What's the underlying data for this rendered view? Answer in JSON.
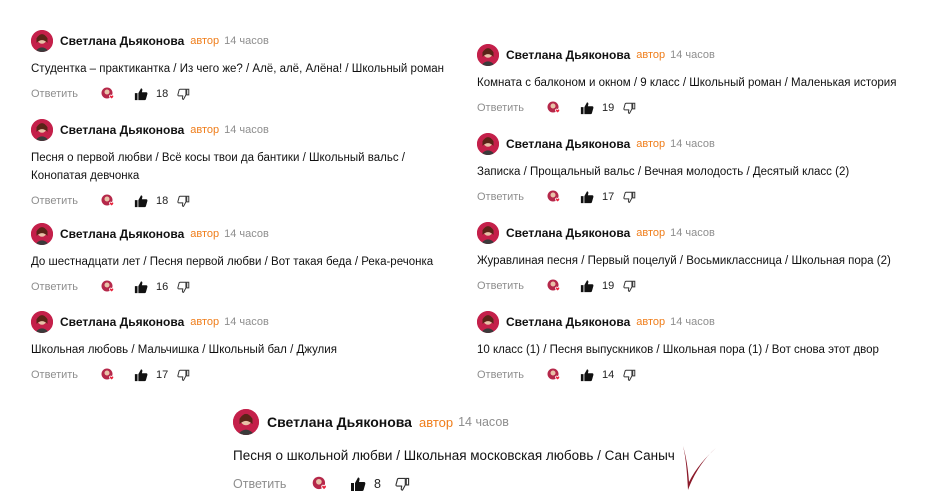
{
  "comments": [
    {
      "author": "Светлана Дьяконова",
      "badge": "автор",
      "time": "14 часов",
      "text": "Студентка – практикантка / Из чего же? / Алё, алё, Алёна! / Школьный роман",
      "reply": "Ответить",
      "likes": "18"
    },
    {
      "author": "Светлана Дьяконова",
      "badge": "автор",
      "time": "14 часов",
      "text": "Песня о первой любви / Всё косы твои да бантики / Школьный вальс / Конопатая девчонка",
      "reply": "Ответить",
      "likes": "18"
    },
    {
      "author": "Светлана Дьяконова",
      "badge": "автор",
      "time": "14 часов",
      "text": "До шестнадцати лет / Песня первой любви / Вот такая беда / Река-речонка",
      "reply": "Ответить",
      "likes": "16"
    },
    {
      "author": "Светлана Дьяконова",
      "badge": "автор",
      "time": "14 часов",
      "text": "Школьная любовь / Мальчишка / Школьный бал / Джулия",
      "reply": "Ответить",
      "likes": "17"
    },
    {
      "author": "Светлана Дьяконова",
      "badge": "автор",
      "time": "14 часов",
      "text": "Комната с балконом и окном / 9 класс / Школьный роман / Маленькая история",
      "reply": "Ответить",
      "likes": "19"
    },
    {
      "author": "Светлана Дьяконова",
      "badge": "автор",
      "time": "14 часов",
      "text": "Записка / Прощальный вальс / Вечная молодость / Десятый класс (2)",
      "reply": "Ответить",
      "likes": "17"
    },
    {
      "author": "Светлана Дьяконова",
      "badge": "автор",
      "time": "14 часов",
      "text": "Журавлиная песня / Первый поцелуй / Восьмиклассница / Школьная пора (2)",
      "reply": "Ответить",
      "likes": "19"
    },
    {
      "author": "Светлана Дьяконова",
      "badge": "автор",
      "time": "14 часов",
      "text": "10 класс (1) / Песня выпускников / Школьная пора (1) / Вот снова этот двор",
      "reply": "Ответить",
      "likes": "14"
    },
    {
      "author": "Светлана Дьяконова",
      "badge": "автор",
      "time": "14 часов",
      "text": "Песня о школьной любви / Школьная московская любовь / Сан Саныч",
      "reply": "Ответить",
      "likes": "8"
    }
  ],
  "icons": {
    "avatar": "avatar-portrait",
    "reaction": "reaction-heart-icon",
    "like": "thumbs-up-icon",
    "dislike": "thumbs-down-icon",
    "mark": "checkmark-icon"
  },
  "colors": {
    "author_badge": "#ef7d1a",
    "muted": "#8e8e8e",
    "avatar_bg": "#c4204a",
    "checkmark": "#8b1a2a"
  }
}
